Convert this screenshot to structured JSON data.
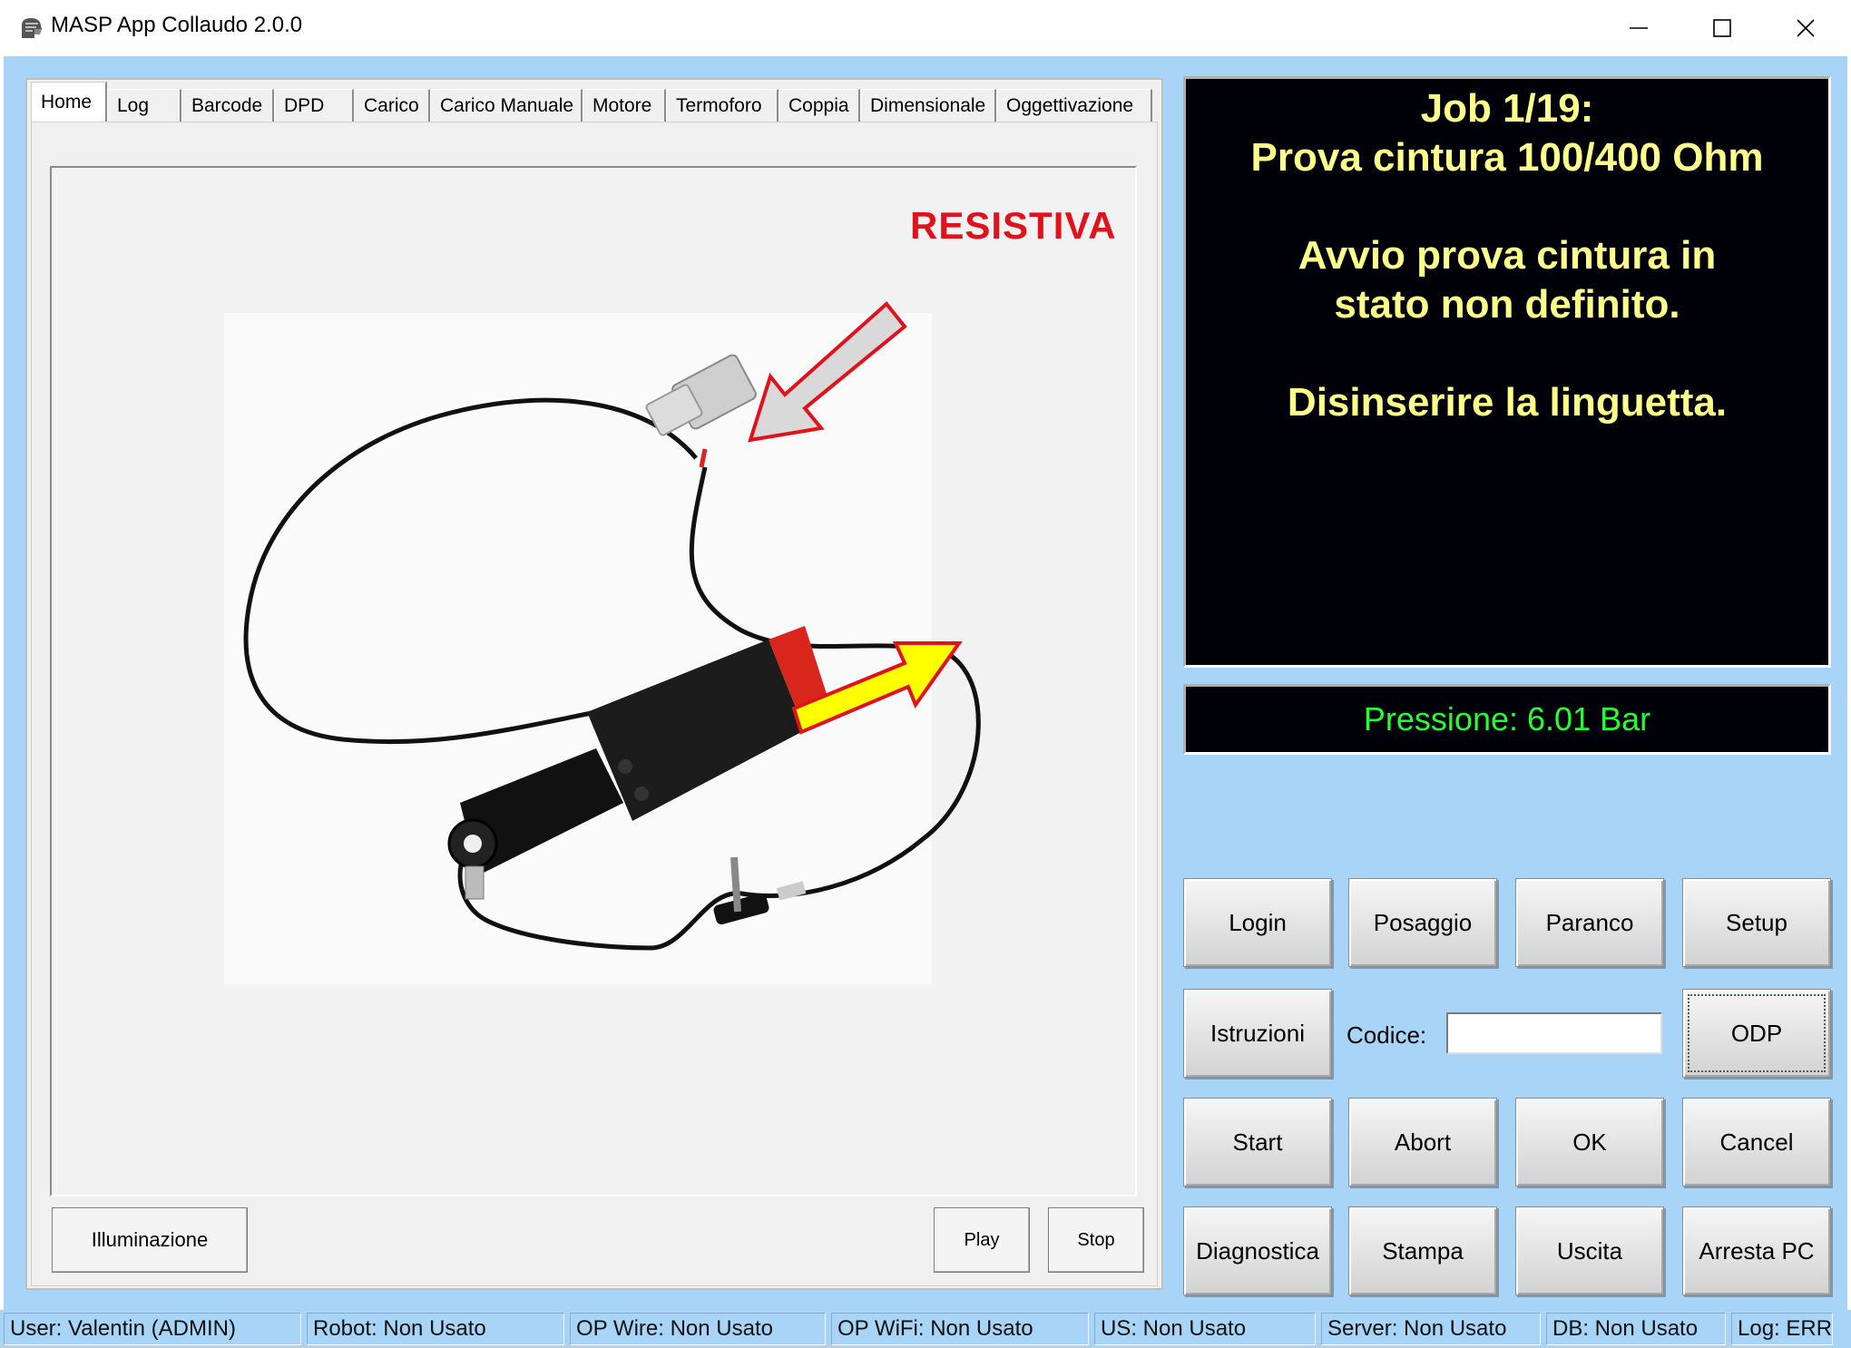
{
  "window": {
    "title": "MASP App Collaudo 2.0.0",
    "icon": "helmet-logo-icon",
    "controls": [
      "minimize-icon",
      "maximize-icon",
      "close-icon"
    ]
  },
  "tabs": [
    {
      "label": "Home",
      "active": true
    },
    {
      "label": "Log"
    },
    {
      "label": "Barcode"
    },
    {
      "label": "DPD"
    },
    {
      "label": "Carico"
    },
    {
      "label": "Carico Manuale"
    },
    {
      "label": "Motore"
    },
    {
      "label": "Termoforo"
    },
    {
      "label": "Coppia"
    },
    {
      "label": "Dimensionale"
    },
    {
      "label": "Oggettivazione"
    }
  ],
  "home": {
    "image_caption": "RESISTIVA",
    "illuminazione_label": "Illuminazione",
    "play_label": "Play",
    "stop_label": "Stop"
  },
  "job_display": {
    "line1": "Job 1/19:",
    "line2": "Prova cintura 100/400 Ohm",
    "line3": "Avvio prova cintura in",
    "line4": "stato non definito.",
    "line5": "Disinserire la linguetta.",
    "text_color": "#ffff8a",
    "background": "#000008"
  },
  "pressure": {
    "text": "Pressione: 6.01 Bar",
    "color": "#22ff33"
  },
  "buttons": {
    "login": "Login",
    "posaggio": "Posaggio",
    "paranco": "Paranco",
    "setup": "Setup",
    "istruzioni": "Istruzioni",
    "codice_label": "Codice:",
    "codice_value": "",
    "odp": "ODP",
    "start": "Start",
    "abort": "Abort",
    "ok": "OK",
    "cancel": "Cancel",
    "diagnostica": "Diagnostica",
    "stampa": "Stampa",
    "uscita": "Uscita",
    "arresta": "Arresta PC"
  },
  "status": {
    "user": "User: Valentin (ADMIN)",
    "robot": "Robot: Non Usato",
    "op_wire": "OP Wire: Non Usato",
    "op_wifi": "OP WiFi: Non Usato",
    "us": "US: Non Usato",
    "server": "Server: Non Usato",
    "db": "DB: Non Usato",
    "log": "Log: ERR"
  },
  "colors": {
    "client_bg": "#a8d4f7",
    "caption_red": "#e0121b"
  }
}
